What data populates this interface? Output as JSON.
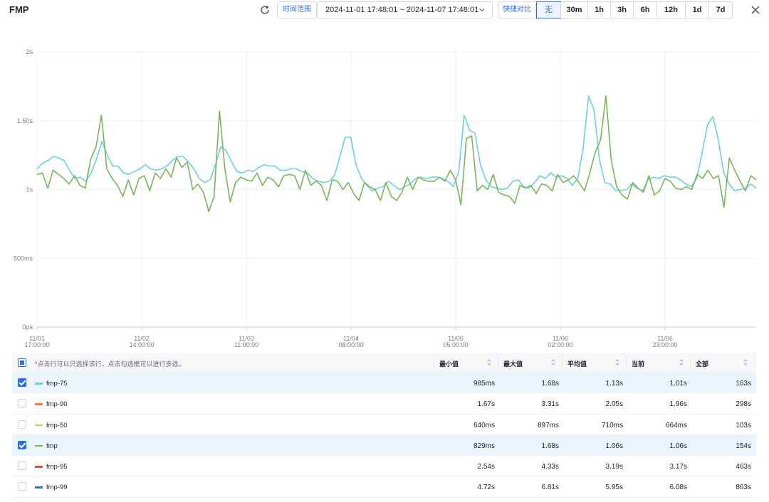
{
  "header": {
    "title": "FMP",
    "time_range_label": "时间范围",
    "range_value": "2024-11-01 17:48:01 ~ 2024-11-07 17:48:01",
    "compare_label": "快捷对比",
    "quick_options": [
      "无",
      "30m",
      "1h",
      "3h",
      "6h",
      "12h",
      "1d",
      "7d"
    ],
    "active_option": "无"
  },
  "chart_data": {
    "type": "line",
    "y_ticks": [
      "2s",
      "1.50s",
      "1s",
      "500ms",
      "0μs"
    ],
    "x_ticks": [
      [
        "11/01",
        "17:00:00"
      ],
      [
        "11/02",
        "14:00:00"
      ],
      [
        "11/03",
        "11:00:00"
      ],
      [
        "11/04",
        "08:00:00"
      ],
      [
        "11/05",
        "05:00:00"
      ],
      [
        "11/06",
        "02:00:00"
      ],
      [
        "11/06",
        "23:00:00"
      ]
    ],
    "ylim": [
      0,
      2
    ],
    "y_unit": "s",
    "x": [
      "2024-11-01 17:00",
      "2024-11-07 17:48"
    ],
    "series": [
      {
        "name": "fmp-75",
        "color": "#6fcfdc",
        "values": [
          1.15,
          1.19,
          1.21,
          1.24,
          1.23,
          1.21,
          1.14,
          1.08,
          1.09,
          1.06,
          1.12,
          1.22,
          1.35,
          1.25,
          1.17,
          1.17,
          1.12,
          1.11,
          1.13,
          1.15,
          1.18,
          1.15,
          1.14,
          1.15,
          1.17,
          1.21,
          1.24,
          1.24,
          1.2,
          1.15,
          1.08,
          1.05,
          1.07,
          1.18,
          1.31,
          1.28,
          1.2,
          1.13,
          1.12,
          1.14,
          1.13,
          1.16,
          1.18,
          1.17,
          1.17,
          1.14,
          1.14,
          1.15,
          1.15,
          1.13,
          1.12,
          1.08,
          1.06,
          1.05,
          1.06,
          1.1,
          1.24,
          1.38,
          1.38,
          1.18,
          1.08,
          1.03,
          0.99,
          1.01,
          1.02,
          1.06,
          1.03,
          1.0,
          1.02,
          1.04,
          1.08,
          1.09,
          1.08,
          1.09,
          1.09,
          1.08,
          1.06,
          1.02,
          1.13,
          1.54,
          1.43,
          1.41,
          1.18,
          1.07,
          1.02,
          1.01,
          1.0,
          1.01,
          1.06,
          1.07,
          1.02,
          1.01,
          1.05,
          1.1,
          1.08,
          1.12,
          1.09,
          1.1,
          1.08,
          1.03,
          1.08,
          1.3,
          1.68,
          1.58,
          1.22,
          1.05,
          1.04,
          0.99,
          0.99,
          1.0,
          1.04,
          1.01,
          0.99,
          1.07,
          1.09,
          1.08,
          1.1,
          1.09,
          1.09,
          1.07,
          1.04,
          1.02,
          1.08,
          1.27,
          1.47,
          1.53,
          1.36,
          1.12,
          1.04,
          0.99,
          1.0,
          1.01,
          1.04,
          1.01
        ]
      },
      {
        "name": "fmp",
        "color": "#7ab55c",
        "values": [
          1.11,
          1.12,
          1.01,
          1.14,
          1.11,
          1.08,
          1.04,
          1.1,
          1.03,
          1.01,
          1.22,
          1.31,
          1.54,
          1.15,
          1.08,
          1.03,
          0.95,
          1.07,
          0.96,
          1.08,
          1.1,
          0.99,
          1.12,
          1.08,
          1.15,
          1.09,
          1.23,
          1.16,
          1.2,
          1.0,
          1.04,
          0.98,
          0.84,
          0.95,
          1.57,
          1.15,
          0.91,
          1.05,
          1.09,
          1.07,
          1.06,
          1.12,
          1.03,
          1.09,
          1.07,
          1.02,
          1.1,
          1.11,
          1.1,
          1.0,
          1.14,
          1.03,
          1.06,
          1.03,
          0.92,
          1.07,
          1.06,
          1.0,
          1.05,
          0.97,
          0.92,
          1.05,
          1.02,
          1.0,
          0.92,
          1.05,
          0.95,
          0.92,
          0.98,
          1.09,
          1.0,
          1.09,
          1.07,
          1.06,
          1.06,
          1.09,
          1.06,
          1.14,
          1.07,
          0.89,
          1.37,
          1.39,
          0.99,
          1.03,
          1.0,
          1.11,
          0.98,
          0.96,
          0.95,
          0.9,
          1.03,
          1.01,
          1.03,
          0.97,
          1.04,
          1.03,
          0.99,
          1.11,
          1.05,
          1.07,
          1.1,
          1.05,
          0.99,
          1.12,
          1.27,
          1.36,
          1.68,
          1.21,
          1.02,
          0.96,
          0.93,
          1.05,
          1.01,
          0.98,
          1.1,
          0.96,
          0.99,
          1.08,
          1.06,
          1.01,
          1.0,
          1.02,
          1.0,
          1.11,
          1.08,
          1.14,
          1.08,
          1.1,
          0.87,
          1.23,
          1.14,
          1.06,
          0.99,
          1.1,
          1.07
        ]
      }
    ]
  },
  "table": {
    "hint": "*点击行可以只选择该行，点击勾选框可以进行多选。",
    "columns": [
      "最小值",
      "最大值",
      "平均值",
      "当前",
      "全部"
    ],
    "rows": [
      {
        "name": "fmp-75",
        "color": "#6fcfdc",
        "checked": true,
        "min": "985ms",
        "max": "1.68s",
        "avg": "1.13s",
        "cur": "1.01s",
        "all": "163s"
      },
      {
        "name": "fmp-90",
        "color": "#f07c3c",
        "checked": false,
        "min": "1.67s",
        "max": "3.31s",
        "avg": "2.05s",
        "cur": "1.96s",
        "all": "298s"
      },
      {
        "name": "fmp-50",
        "color": "#f2be3a",
        "checked": false,
        "min": "640ms",
        "max": "897ms",
        "avg": "710ms",
        "cur": "664ms",
        "all": "103s"
      },
      {
        "name": "fmp",
        "color": "#7ab55c",
        "checked": true,
        "min": "829ms",
        "max": "1.68s",
        "avg": "1.06s",
        "cur": "1.06s",
        "all": "154s"
      },
      {
        "name": "fmp-95",
        "color": "#e24b3c",
        "checked": false,
        "min": "2.54s",
        "max": "4.33s",
        "avg": "3.19s",
        "cur": "3.17s",
        "all": "463s"
      },
      {
        "name": "fmp-99",
        "color": "#2f6fbf",
        "checked": false,
        "min": "4.72s",
        "max": "6.81s",
        "avg": "5.95s",
        "cur": "6.08s",
        "all": "863s"
      }
    ]
  }
}
